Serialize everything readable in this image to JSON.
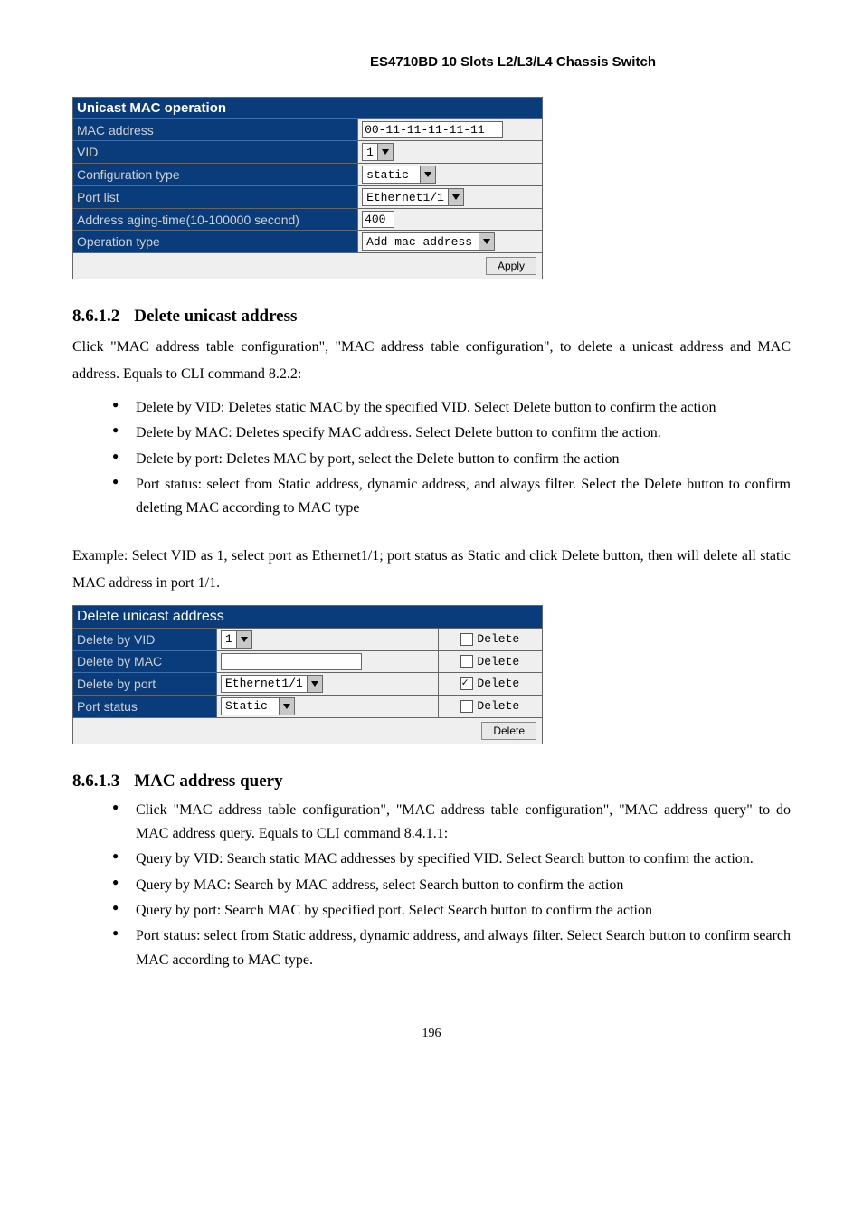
{
  "header": "ES4710BD 10 Slots L2/L3/L4 Chassis Switch",
  "table1": {
    "title": "Unicast MAC operation",
    "rows": {
      "mac_label": "MAC address",
      "mac_value": "00-11-11-11-11-11",
      "vid_label": "VID",
      "vid_value": "1",
      "cfgtype_label": "Configuration type",
      "cfgtype_value": "static",
      "portlist_label": "Port list",
      "portlist_value": "Ethernet1/1",
      "aging_label": "Address aging-time(10-100000 second)",
      "aging_value": "400",
      "optype_label": "Operation type",
      "optype_value": "Add mac address",
      "apply": "Apply"
    }
  },
  "sec1": {
    "num": "8.6.1.2",
    "title": "Delete unicast address",
    "p1": "Click \"MAC address table configuration\", \"MAC address table configuration\", to delete a unicast address and MAC address. Equals to CLI command 8.2.2:",
    "b1": "Delete by VID: Deletes static MAC by the specified VID. Select Delete button to confirm the action",
    "b2": "Delete by MAC: Deletes specify MAC address. Select Delete button to confirm the action.",
    "b3": "Delete by port: Deletes MAC by port, select the Delete button to confirm the action",
    "b4": "Port status: select from Static address, dynamic address, and always filter. Select the Delete button to confirm deleting MAC according to MAC type",
    "p2": "Example: Select VID as 1, select port as Ethernet1/1; port status as Static and click Delete button, then will delete all static MAC address in port 1/1."
  },
  "table2": {
    "title": "Delete unicast address",
    "rows": {
      "byvid_label": "Delete by VID",
      "byvid_value": "1",
      "bymac_label": "Delete by MAC",
      "bymac_value": "",
      "byport_label": "Delete by port",
      "byport_value": "Ethernet1/1",
      "status_label": "Port status",
      "status_value": "Static",
      "chk_label": "Delete",
      "delete_btn": "Delete"
    }
  },
  "sec2": {
    "num": "8.6.1.3",
    "title": "MAC address query",
    "b1": "Click \"MAC address table configuration\", \"MAC address table configuration\", \"MAC address query\" to do MAC address query. Equals to CLI command 8.4.1.1:",
    "b2": "Query by VID: Search static MAC addresses by specified VID. Select Search button to confirm the action.",
    "b3": "Query by MAC: Search by MAC address, select Search button to confirm the action",
    "b4": "Query by port: Search MAC by specified port. Select Search button to confirm the action",
    "b5": "Port status: select from Static address, dynamic address, and always filter. Select Search button to confirm search MAC according to MAC type."
  },
  "page": "196"
}
